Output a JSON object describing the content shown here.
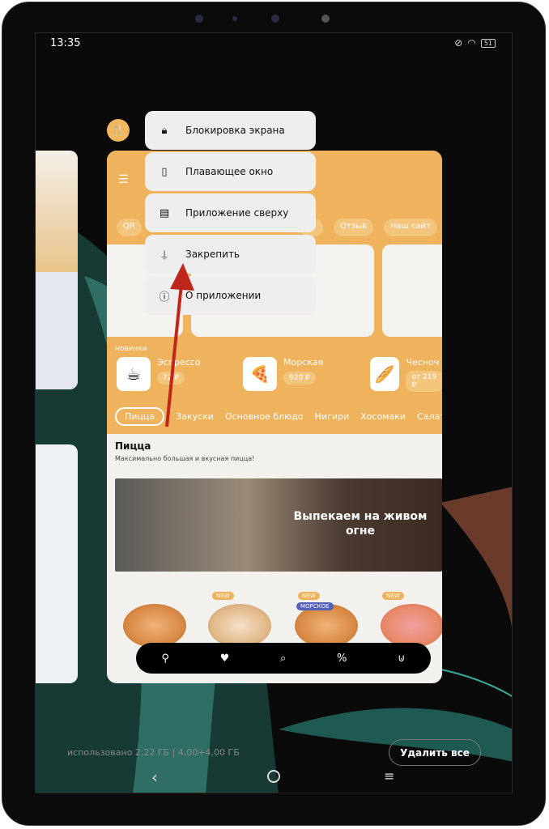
{
  "status_bar": {
    "time": "13:35",
    "battery": "51"
  },
  "context_menu": {
    "items": [
      {
        "icon": "lock-icon",
        "label": "Блокировка экрана"
      },
      {
        "icon": "floating-window-icon",
        "label": "Плавающее окно"
      },
      {
        "icon": "split-screen-icon",
        "label": "Приложение сверху"
      },
      {
        "icon": "pin-icon",
        "label": "Закрепить"
      },
      {
        "icon": "info-icon",
        "label": "О приложении"
      }
    ]
  },
  "app": {
    "top_pills": [
      "QR",
      "ла",
      "Отзыв",
      "Наш сайт"
    ],
    "new_label": "новинки",
    "products": [
      {
        "name": "Эспрессо",
        "price": "72 ₽"
      },
      {
        "name": "Морская",
        "price": "920 ₽"
      },
      {
        "name": "Чесноч",
        "price": "от 219 ₽"
      }
    ],
    "categories": [
      "Пицца",
      "Закуски",
      "Основное блюдо",
      "Нигири",
      "Хосомаки",
      "Салаты"
    ],
    "section_title": "Пицца",
    "section_subtitle": "Максимально большая и вкусная пицца!",
    "hero_text": "Выпекаем на живом огне",
    "badges": [
      "NEW",
      "NEW",
      "МОРСКОЕ",
      "NEW"
    ],
    "bottom_nav": [
      "location-icon",
      "heart-icon",
      "search-icon",
      "percent-icon",
      "basket-icon"
    ]
  },
  "recents": {
    "memory": "использовано 2,22 ГБ | 4,00+4,00 ГБ",
    "clear_all": "Удалить все"
  },
  "annotation_color": "#c0261b"
}
